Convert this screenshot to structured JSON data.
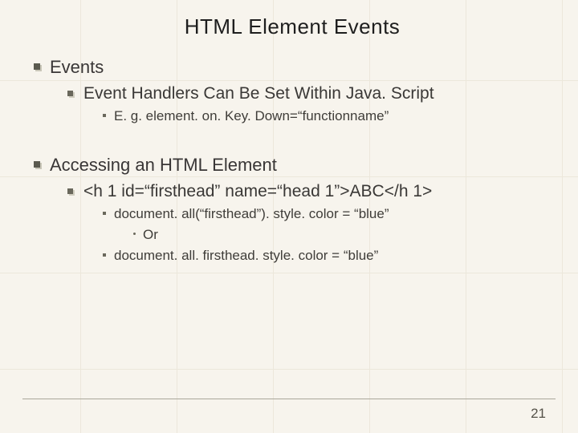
{
  "title": "HTML Element Events",
  "bullets": {
    "l1a": "Events",
    "l2a": "Event Handlers Can Be Set Within Java. Script",
    "l3a": "E. g. element. on. Key. Down=“functionname”",
    "l1b": "Accessing an HTML Element",
    "l2b": "<h 1 id=“firsthead” name=“head 1”>ABC</h 1>",
    "l3b": "document. all(“firsthead”). style. color = “blue”",
    "l4a": "Or",
    "l3c": "document. all. firsthead. style. color = “blue”"
  },
  "page_number": "21"
}
